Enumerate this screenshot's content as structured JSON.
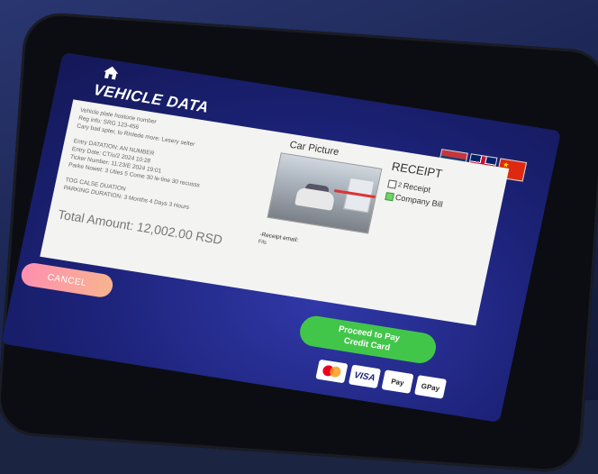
{
  "header": {
    "title": "VEHICLE DATA",
    "icons": {
      "home": "home-icon"
    },
    "flags": [
      "serbia-flag",
      "uk-flag",
      "china-flag"
    ]
  },
  "vehicle_info": {
    "lines": [
      "Vehicle plate hostorie number",
      "Reg info: SRG 123-456",
      "Cary bad spter, to Rinlede more: Lesery selter"
    ],
    "entry_lines": [
      "Entry DATATION: AN NUMBER",
      "Entry Date: CT/o/2 2024 10:28",
      "Ticker Number: 11:23/E 2024 19:01",
      "Parke Nowet: 3 Uties 5 Come 30 le-tine 30 recusss"
    ],
    "duration_lines": [
      "TOG CALSE DUATION",
      "PARKING DURATION: 3 Months 4 Days 3 Hours"
    ],
    "total": "Total Amount: 12,002.00 RSD"
  },
  "car": {
    "title": "Car Picture",
    "receipt_email": "-Receipt email:",
    "fills": "Fils"
  },
  "receipt": {
    "title": "RECEIPT",
    "options": [
      {
        "label": "Receipt",
        "prefix": "2",
        "checked": false
      },
      {
        "label": "Company Bill",
        "prefix": "",
        "checked": true
      }
    ]
  },
  "actions": {
    "cancel": "CANCEL",
    "pay_line1": "Proceed to Pay",
    "pay_line2": "Credit Card"
  },
  "payment_methods": {
    "mastercard": "mastercard",
    "visa": "VISA",
    "apple_pay": "Pay",
    "google_pay": "GPay"
  },
  "colors": {
    "screen_bg": "#1c2277",
    "pay_button": "#42c64a",
    "cancel_button": "#ff8fb0"
  }
}
